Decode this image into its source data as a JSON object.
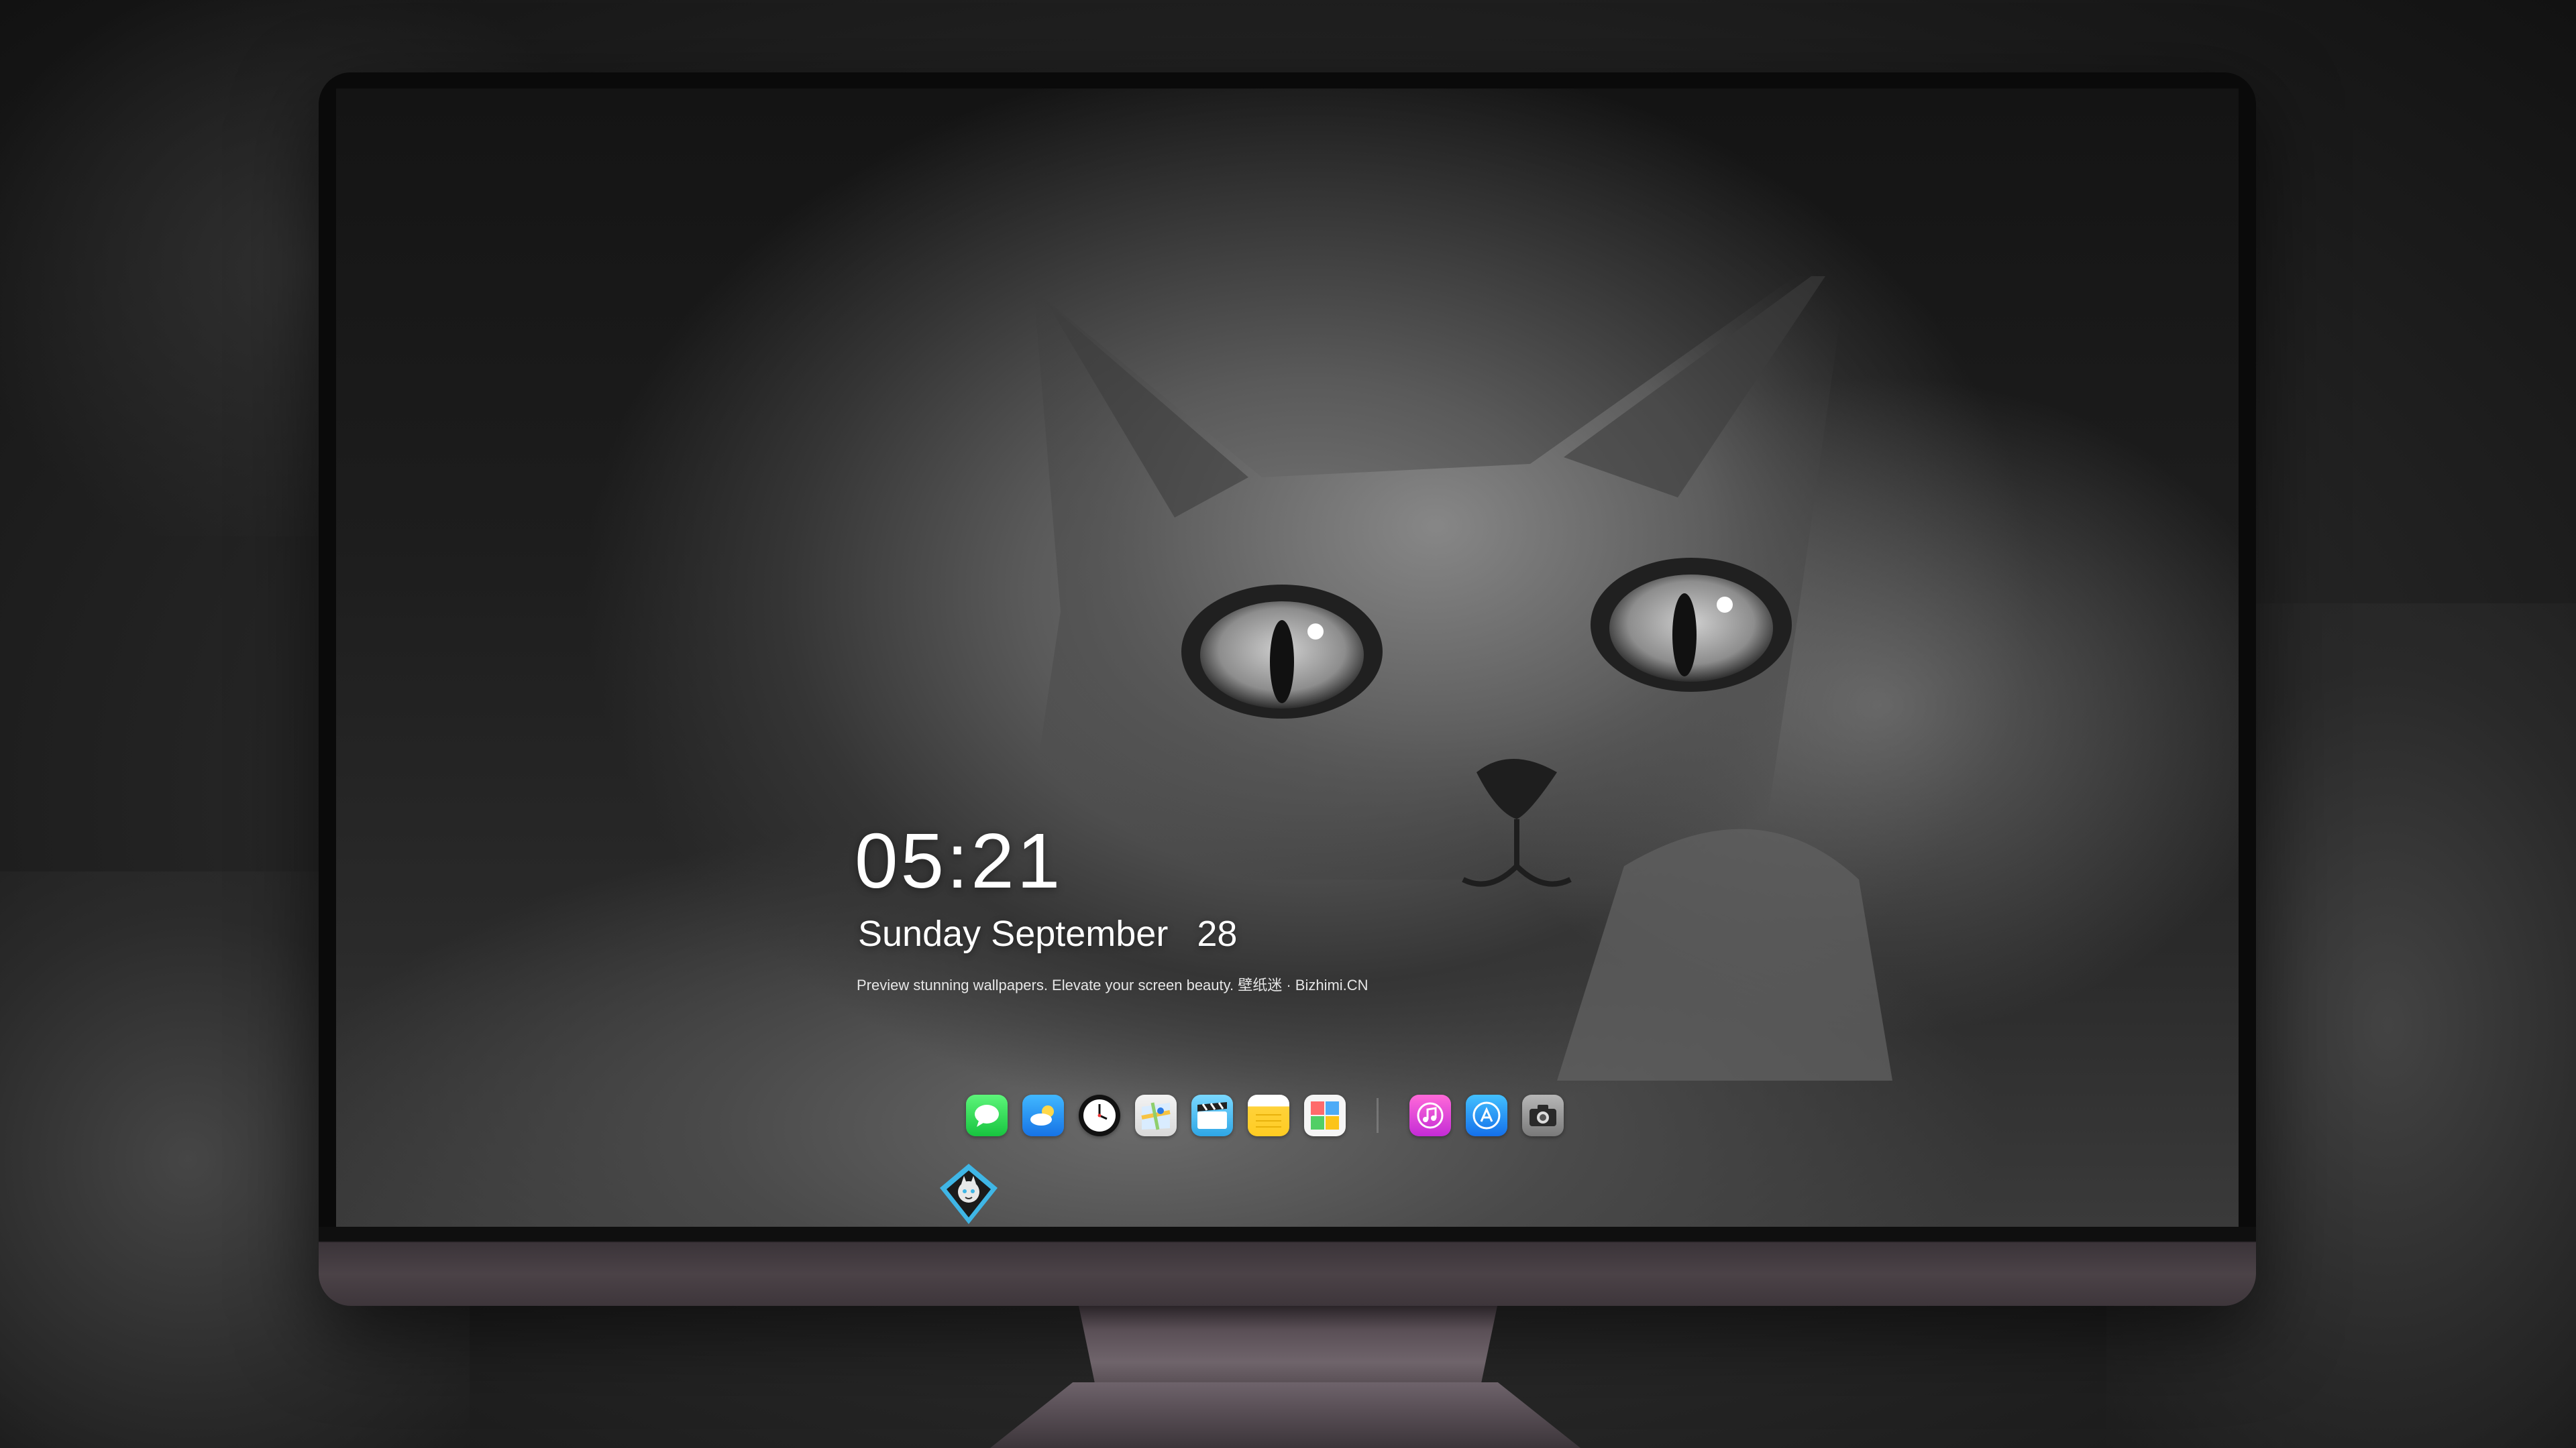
{
  "lock_screen": {
    "time": "05:21",
    "weekday": "Sunday",
    "month": "September",
    "day": "28",
    "tagline": "Preview stunning wallpapers. Elevate your screen beauty. 壁纸迷 · Bizhimi.CN"
  },
  "wallpaper": {
    "subject": "gray-kitten"
  },
  "dock": {
    "left_group": [
      {
        "icon": "messages-icon"
      },
      {
        "icon": "weather-icon"
      },
      {
        "icon": "clock-icon"
      },
      {
        "icon": "maps-icon"
      },
      {
        "icon": "videos-icon"
      },
      {
        "icon": "notes-icon"
      },
      {
        "icon": "photos-icon"
      }
    ],
    "right_group": [
      {
        "icon": "music-icon"
      },
      {
        "icon": "app-store-icon"
      },
      {
        "icon": "camera-icon"
      }
    ]
  },
  "monitor": {
    "logo": "bizhimi-logo-icon"
  },
  "colors": {
    "messages": "#17c43f",
    "weather": "#1673e6",
    "music": "#c42bd6",
    "app_store": "#1470ea",
    "chin": "#4b4247"
  }
}
